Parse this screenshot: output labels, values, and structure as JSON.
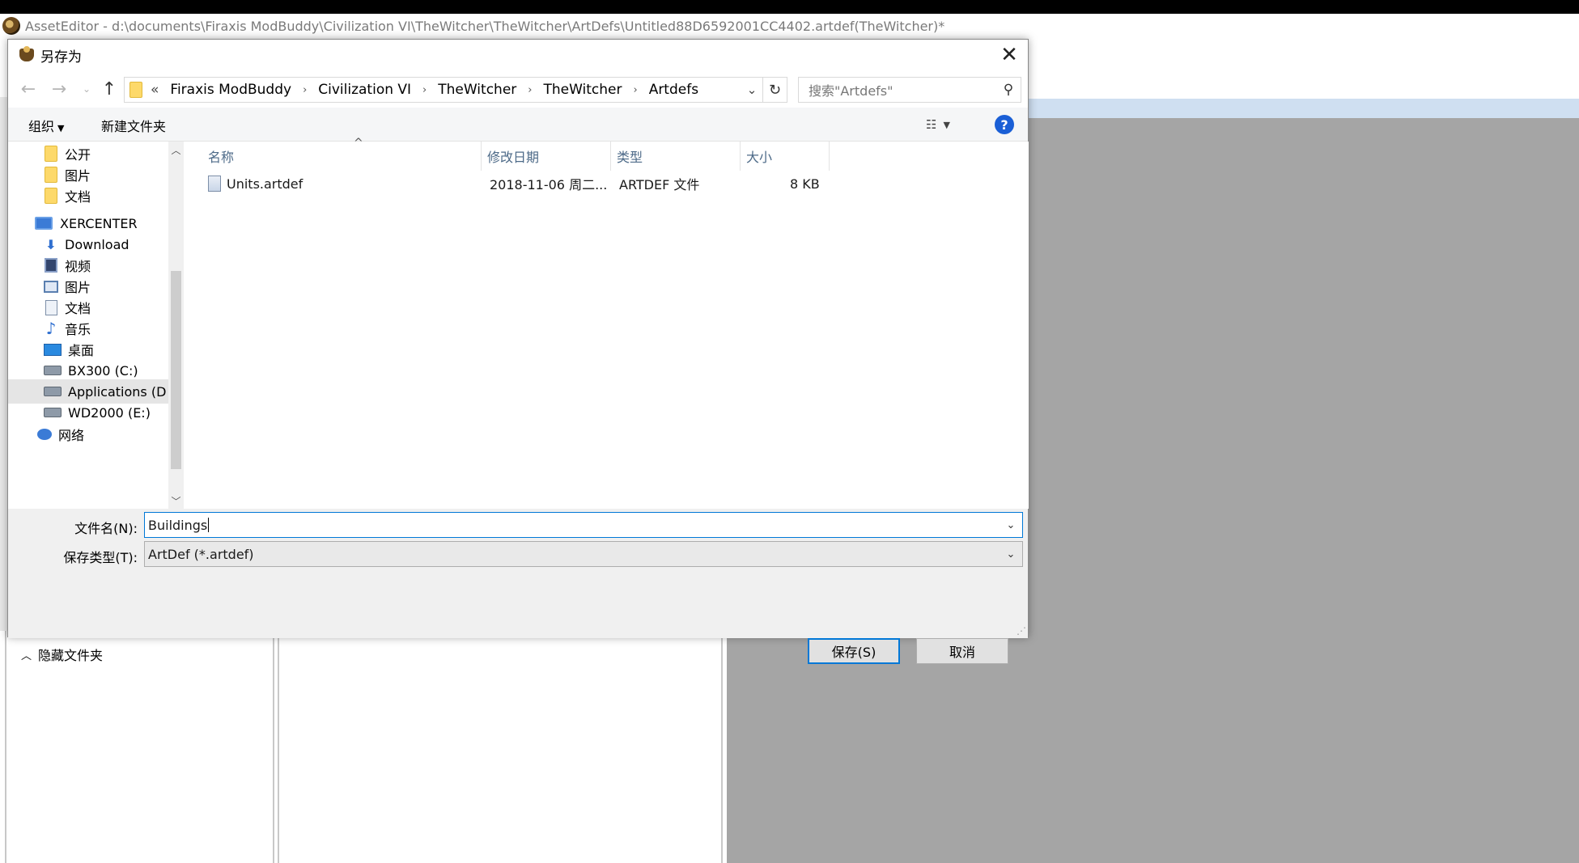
{
  "app": {
    "title": "AssetEditor - d:\\documents\\Firaxis ModBuddy\\Civilization VI\\TheWitcher\\TheWitcher\\ArtDefs\\Untitled88D6592001CC4402.artdef(TheWitcher)*"
  },
  "dialog": {
    "title": "另存为",
    "close_glyph": "✕",
    "breadcrumb": [
      "Firaxis ModBuddy",
      "Civilization VI",
      "TheWitcher",
      "TheWitcher",
      "Artdefs"
    ],
    "breadcrumb_overflow": "«",
    "search_placeholder": "搜索\"Artdefs\"",
    "toolbar": {
      "organize": "组织",
      "new_folder": "新建文件夹",
      "help": "?"
    },
    "sidebar": {
      "items": [
        {
          "label": "公开",
          "icon": "folder-icon"
        },
        {
          "label": "图片",
          "icon": "folder-icon"
        },
        {
          "label": "文档",
          "icon": "folder-icon"
        },
        {
          "label": "XERCENTER",
          "icon": "computer-icon"
        },
        {
          "label": "Download",
          "icon": "download-icon"
        },
        {
          "label": "视频",
          "icon": "video-icon"
        },
        {
          "label": "图片",
          "icon": "picture-icon"
        },
        {
          "label": "文档",
          "icon": "document-icon"
        },
        {
          "label": "音乐",
          "icon": "music-icon"
        },
        {
          "label": "桌面",
          "icon": "desktop-icon"
        },
        {
          "label": "BX300 (C:)",
          "icon": "drive-icon"
        },
        {
          "label": "Applications (D",
          "icon": "drive-icon",
          "selected": true
        },
        {
          "label": "WD2000 (E:)",
          "icon": "drive-icon"
        },
        {
          "label": "网络",
          "icon": "network-icon"
        }
      ]
    },
    "columns": [
      "名称",
      "修改日期",
      "类型",
      "大小"
    ],
    "files": [
      {
        "name": "Units.artdef",
        "modified": "2018-11-06 周二...",
        "type": "ARTDEF 文件",
        "size": "8 KB"
      }
    ],
    "filename_label": "文件名(N):",
    "filename_value": "Buildings",
    "filetype_label": "保存类型(T):",
    "filetype_value": "ArtDef (*.artdef)",
    "hide_folders": "隐藏文件夹",
    "save_button": "保存(S)",
    "cancel_button": "取消"
  }
}
